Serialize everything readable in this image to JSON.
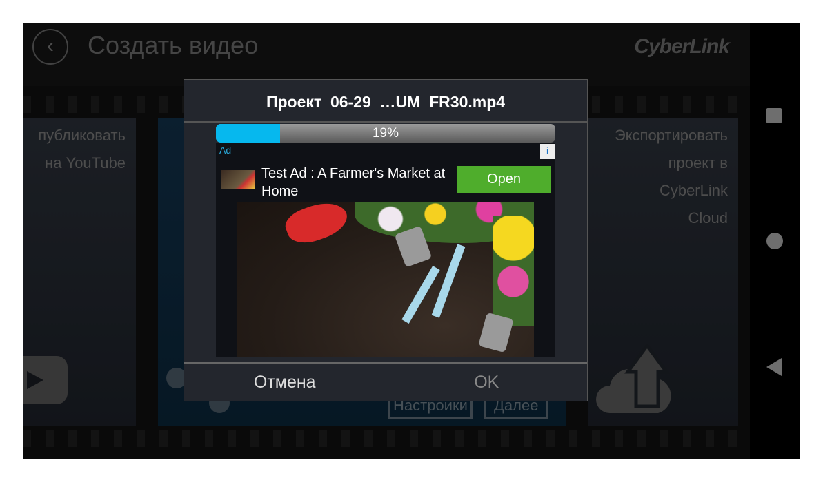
{
  "header": {
    "title": "Создать видео",
    "logo": "CyberLink",
    "back_icon": "chevron-left-circle-icon"
  },
  "cards": {
    "left": {
      "lines": [
        "публиковать",
        "на YouTube"
      ],
      "icon": "youtube-play-icon"
    },
    "center": {
      "settings_label": "Настройки",
      "next_label": "Далее"
    },
    "right": {
      "lines": [
        "Экспортировать",
        "проект в",
        "CyberLink",
        "Cloud"
      ],
      "icon": "cloud-upload-icon"
    }
  },
  "dialog": {
    "title": "Проект_06-29_…UM_FR30.mp4",
    "progress_percent": 19,
    "progress_text": "19%",
    "ad": {
      "label": "Ad",
      "info_icon": "info-icon",
      "headline": "Test Ad : A Farmer's Market at Home",
      "open_label": "Open"
    },
    "cancel_label": "Отмена",
    "ok_label": "OK"
  },
  "nav": {
    "icons": [
      "square-recents-icon",
      "circle-home-icon",
      "triangle-back-icon"
    ]
  },
  "colors": {
    "progress": "#06b8ee",
    "open_button": "#4fad2c"
  }
}
